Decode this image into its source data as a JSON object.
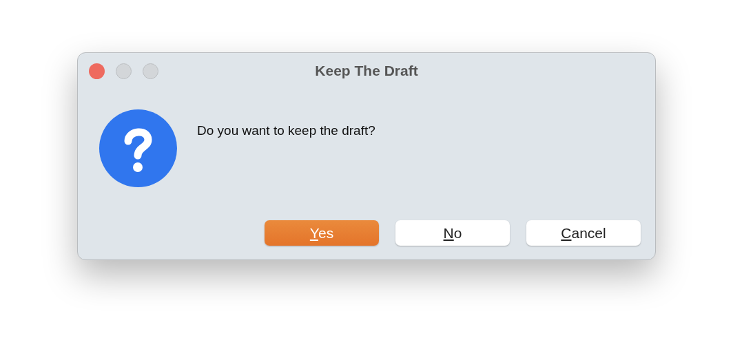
{
  "window": {
    "title": "Keep The Draft",
    "traffic_lights": [
      {
        "kind": "close",
        "disabled": false
      },
      {
        "kind": "minimize",
        "disabled": true
      },
      {
        "kind": "zoom",
        "disabled": true
      }
    ]
  },
  "message": "Do you want to keep the draft?",
  "buttons": [
    {
      "label": "Yes",
      "default": true,
      "mnemonic_underlined": true
    },
    {
      "label": "No",
      "default": false,
      "mnemonic_underlined": true
    },
    {
      "label": "Cancel",
      "default": false,
      "mnemonic_underlined": true
    }
  ]
}
